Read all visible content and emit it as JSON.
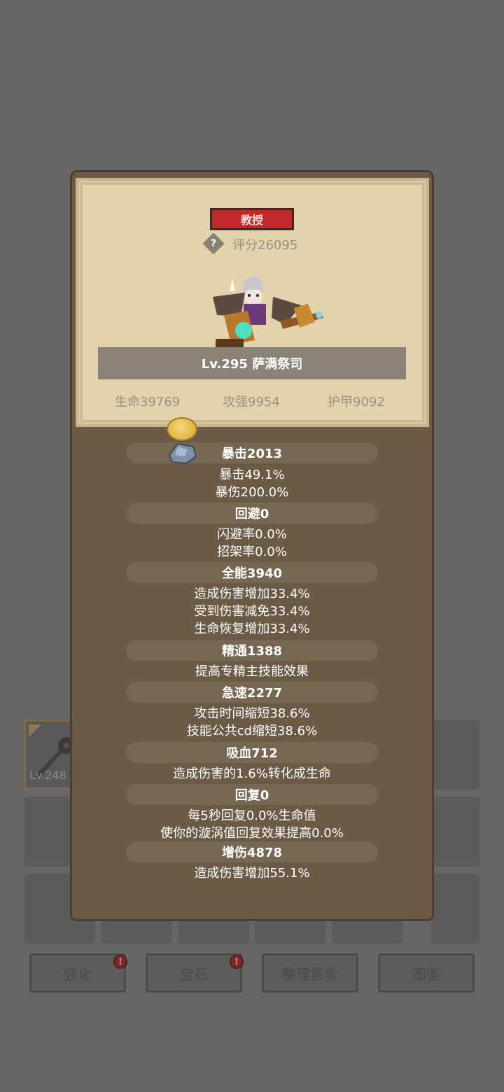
{
  "background": {
    "equipped_level": "Lv.248",
    "buttons": [
      "强化",
      "宝石",
      "整理售卖",
      "图鉴"
    ],
    "badge": "!"
  },
  "character": {
    "rank": "教授",
    "help": "?",
    "score": "评分26095",
    "name": "Lv.295 萨满祭司",
    "hp": "生命39769",
    "attack": "攻强9954",
    "armor": "护甲9092"
  },
  "stats": [
    {
      "title": "暴击2013",
      "details": [
        "暴击49.1%",
        "暴伤200.0%"
      ]
    },
    {
      "title": "回避0",
      "details": [
        "闪避率0.0%",
        "招架率0.0%"
      ]
    },
    {
      "title": "全能3940",
      "details": [
        "造成伤害增加33.4%",
        "受到伤害减免33.4%",
        "生命恢复增加33.4%"
      ]
    },
    {
      "title": "精通1388",
      "details": [
        "提高专精主技能效果"
      ]
    },
    {
      "title": "急速2277",
      "details": [
        "攻击时间缩短38.6%",
        "技能公共cd缩短38.6%"
      ]
    },
    {
      "title": "吸血712",
      "details": [
        "造成伤害的1.6%转化成生命"
      ]
    },
    {
      "title": "回复0",
      "details": [
        "每5秒回复0.0%生命值",
        "使你的漩涡值回复效果提高0.0%"
      ]
    },
    {
      "title": "增伤4878",
      "details": [
        "造成伤害增加55.1%"
      ]
    }
  ],
  "colors": {
    "popup_bg": "#6b5a45",
    "parchment": "#e3d3ad",
    "rank_red": "#c0282b",
    "section_bar": "#766752"
  }
}
